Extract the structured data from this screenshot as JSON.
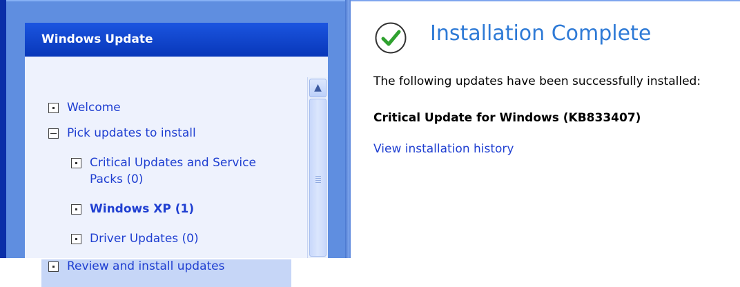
{
  "panel": {
    "title": "Windows Update",
    "items": [
      {
        "label": "Welcome"
      },
      {
        "label": "Pick updates to install"
      },
      {
        "label_line1": "Critical Updates and Service",
        "label_line2": "Packs (0)"
      },
      {
        "label": "Windows XP (1)"
      },
      {
        "label": "Driver Updates (0)"
      },
      {
        "label": "Review and install updates"
      }
    ]
  },
  "content": {
    "title": "Installation Complete",
    "description": "The following updates have been successfully installed:",
    "update_name": "Critical Update for Windows (KB833407)",
    "history_link": "View installation history"
  },
  "icons": {
    "status": "checkmark-icon",
    "scroll_up": "chevron-up-icon",
    "item_box": "box-icon"
  },
  "colors": {
    "header_blue": "#0a3fcf",
    "link_blue": "#1f3fd1",
    "title_blue": "#2e7ad6",
    "check_green": "#2fa12f"
  }
}
